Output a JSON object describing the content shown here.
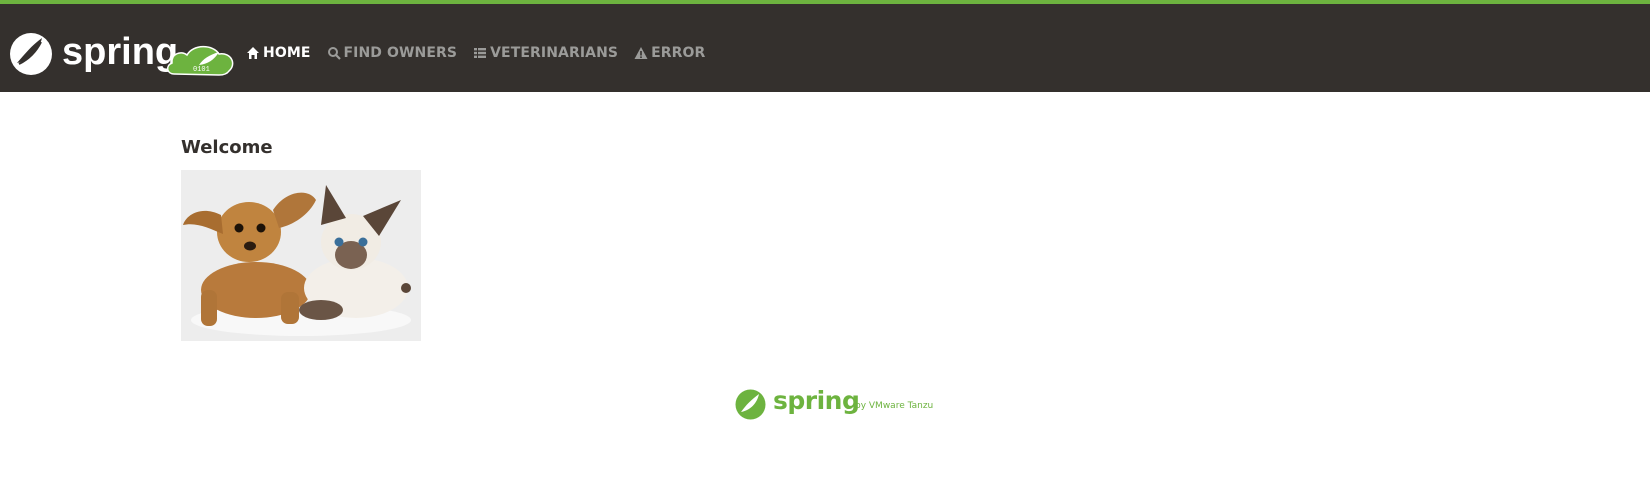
{
  "brand": {
    "logo_text": "spring",
    "badge_text": "0101",
    "accent_color": "#6db33f",
    "navbar_color": "#34302d"
  },
  "nav": {
    "items": [
      {
        "label": "HOME",
        "icon": "home-icon",
        "active": true
      },
      {
        "label": "FIND OWNERS",
        "icon": "search-icon",
        "active": false
      },
      {
        "label": "VETERINARIANS",
        "icon": "list-icon",
        "active": false
      },
      {
        "label": "ERROR",
        "icon": "warning-icon",
        "active": false
      }
    ]
  },
  "main": {
    "title": "Welcome",
    "image": "pets-photo"
  },
  "footer": {
    "logo_text": "spring",
    "byline": "by VMware Tanzu"
  }
}
